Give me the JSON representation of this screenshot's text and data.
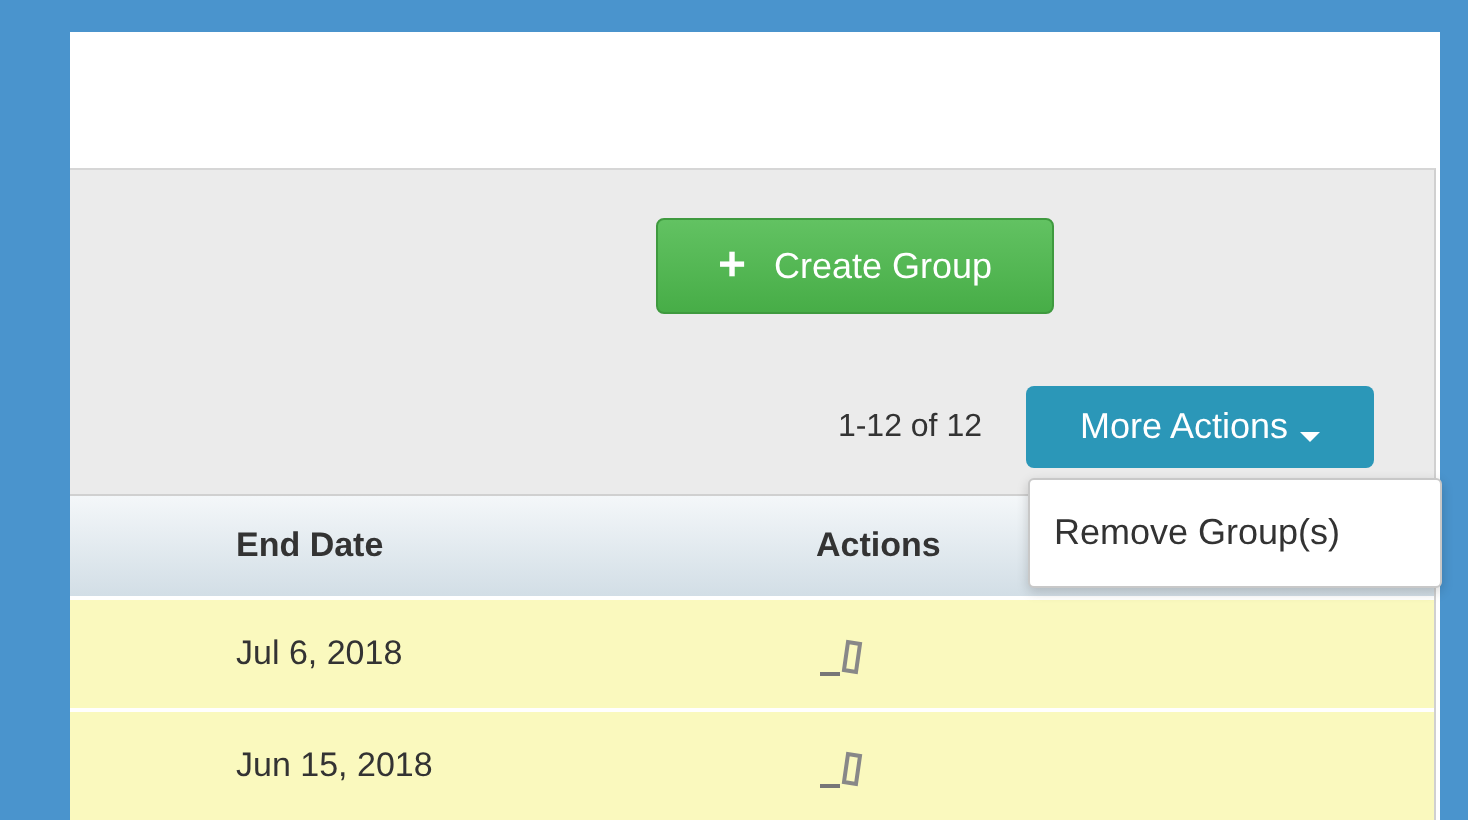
{
  "toolbar": {
    "create_button": {
      "icon": "+",
      "label": "Create Group"
    },
    "count": "1-12 of 12",
    "more_actions": {
      "label": "More Actions",
      "expanded": true,
      "menu": [
        "Remove Group(s)"
      ]
    }
  },
  "table": {
    "columns": [
      "End Date",
      "Actions"
    ],
    "rows": [
      {
        "end_date": "Jul 6, 2018"
      },
      {
        "end_date": "Jun 15, 2018"
      }
    ]
  }
}
